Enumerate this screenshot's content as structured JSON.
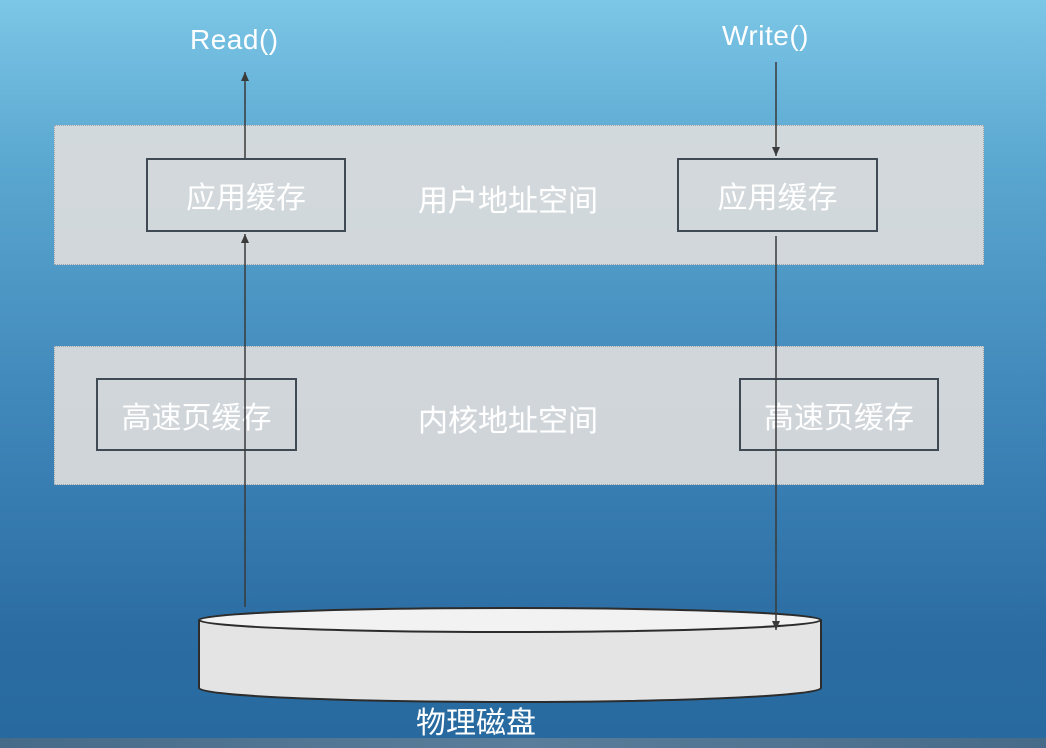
{
  "io": {
    "read_label": "Read()",
    "write_label": "Write()"
  },
  "user_space": {
    "title": "用户地址空间",
    "left_box": "应用缓存",
    "right_box": "应用缓存"
  },
  "kernel_space": {
    "title": "内核地址空间",
    "left_box": "高速页缓存",
    "right_box": "高速页缓存"
  },
  "disk": {
    "label": "物理磁盘"
  },
  "colors": {
    "band_fill": "#dcdcdc",
    "box_border": "#3f4a55",
    "arrow": "#3a3a3a",
    "text": "#ffffff",
    "background_top": "#7cc6e6",
    "background_bottom": "#276aa0"
  }
}
